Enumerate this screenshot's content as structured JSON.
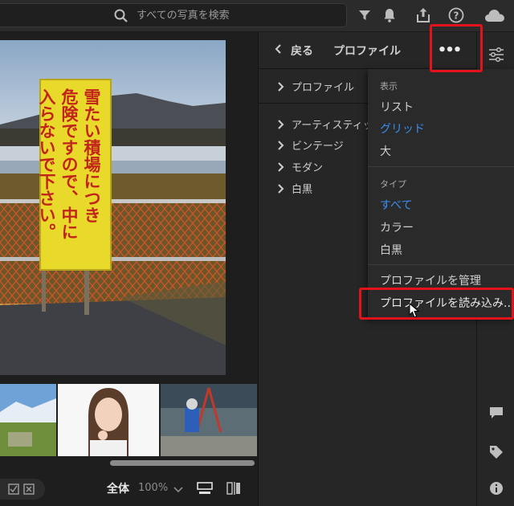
{
  "search": {
    "placeholder": "すべての写真を検索"
  },
  "toolbar": {
    "icons": [
      "filter-icon",
      "bell-icon",
      "share-icon",
      "help-icon",
      "cloud-icon"
    ]
  },
  "panel": {
    "back_label": "戻る",
    "title": "プロファイル",
    "more_label": "•••",
    "top_item": "プロファイル",
    "groups": [
      "アーティスティック",
      "ビンテージ",
      "モダン",
      "白黒"
    ]
  },
  "menu": {
    "display_heading": "表示",
    "display_items": [
      "リスト",
      "グリッド",
      "大"
    ],
    "display_selected": "グリッド",
    "type_heading": "タイプ",
    "type_items": [
      "すべて",
      "カラー",
      "白黒"
    ],
    "type_selected": "すべて",
    "manage_label": "プロファイルを管理",
    "import_label": "プロファイルを読み込み..."
  },
  "bottombar": {
    "view_label": "全体",
    "zoom_level": "100%"
  },
  "sign": {
    "text_col1": "雪たい積場につき",
    "text_col2": "危険ですので、中に",
    "text_col3": "入らないで下さい。"
  },
  "colors": {
    "accent_blue": "#3b8df0",
    "highlight_red": "#e4121b",
    "sign_yellow": "#e8d92a"
  }
}
